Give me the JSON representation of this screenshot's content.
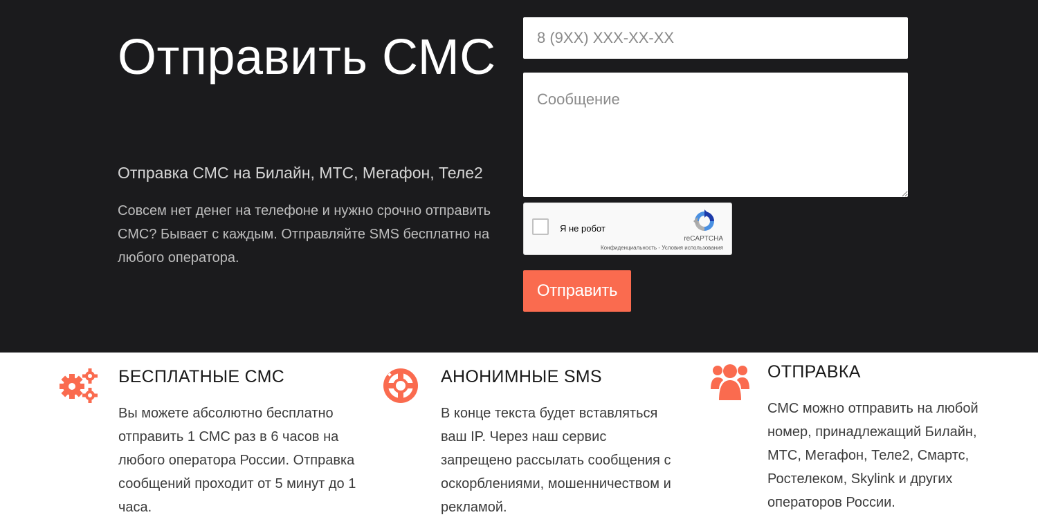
{
  "hero": {
    "title": "Отправить СМС",
    "subtitle": "Отправка СМС на Билайн, МТС, Мегафон, Теле2",
    "description": "Совсем нет денег на телефоне и нужно срочно отправить СМС? Бывает с каждым. Отправляйте SMS бесплатно на любого оператора."
  },
  "form": {
    "phone_placeholder": "8 (9XX) XXX-XX-XX",
    "message_placeholder": "Сообщение",
    "captcha": {
      "label": "Я не робот",
      "brand": "reCAPTCHA",
      "privacy": "Конфиденциальность",
      "separator": " - ",
      "terms": "Условия использования"
    },
    "submit_label": "Отправить"
  },
  "features": [
    {
      "icon": "gears-icon",
      "title": "БЕСПЛАТНЫЕ СМС",
      "text": "Вы можете абсолютно бесплатно отправить 1 СМС раз в 6 часов на любого оператора России. Отправка сообщений проходит от 5 минут до 1 часа."
    },
    {
      "icon": "life-ring-icon",
      "title": "АНОНИМНЫЕ SMS",
      "text": "В конце текста будет вставляться ваш IP. Через наш сервис запрещено рассылать сообщения с оскорблениями, мошенничеством и рекламой."
    },
    {
      "icon": "users-icon",
      "title": "ОТПРАВКА",
      "text": "СМС можно отправить на любой номер, принадлежащий Билайн, МТС, Мегафон, Теле2, Смартс, Ростелеком, Skylink и других операторов России."
    }
  ],
  "colors": {
    "hero_background": "#1b1b1d",
    "accent": "#fa6b4f"
  }
}
